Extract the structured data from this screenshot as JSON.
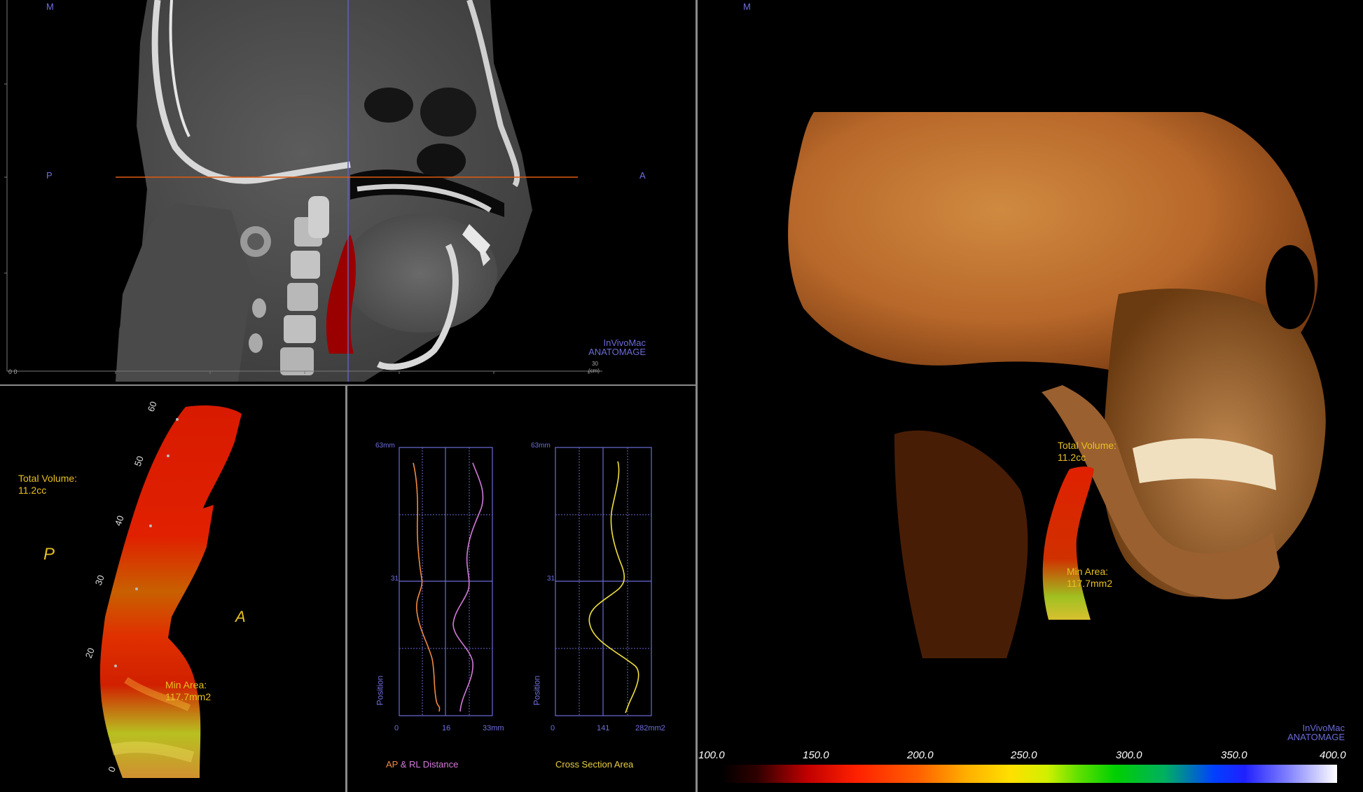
{
  "sagittal": {
    "top_marker": "M",
    "left_marker": "P",
    "right_marker": "A",
    "origin": "0 0",
    "scale_number": "30",
    "scale_unit": "(cm)",
    "watermark_line1": "InVivoMac",
    "watermark_line2": "ANATOMAGE"
  },
  "airway3d": {
    "total_volume_label": "Total Volume:",
    "total_volume_value": "11.2cc",
    "min_area_label": "Min Area:",
    "min_area_value": "117.7mm2",
    "posterior_label": "P",
    "anterior_label": "A",
    "ruler_ticks": [
      "60",
      "50",
      "40",
      "30",
      "20",
      "0"
    ]
  },
  "graphs": {
    "top_label": "63mm",
    "mid_label": "31",
    "y_axis_label": "Position",
    "left_x_ticks": [
      "0",
      "16",
      "33mm"
    ],
    "right_x_ticks": [
      "0",
      "141",
      "282mm2"
    ],
    "left_caption_ap": "AP",
    "left_caption_rest": "& RL Distance",
    "right_caption": "Cross Section Area",
    "colors": {
      "ap": "#f08a40",
      "rl": "#d37ad8",
      "area": "#f0e040",
      "grid": "#6a6ad8"
    }
  },
  "volume": {
    "top_marker": "M",
    "total_volume_label": "Total Volume:",
    "total_volume_value": "11.2cc",
    "min_area_label": "Min Area:",
    "min_area_value": "117.7mm2",
    "watermark_line1": "InVivoMac",
    "watermark_line2": "ANATOMAGE"
  },
  "colorbar": {
    "labels": [
      "100.0",
      "150.0",
      "200.0",
      "250.0",
      "300.0",
      "350.0",
      "400.0"
    ]
  }
}
